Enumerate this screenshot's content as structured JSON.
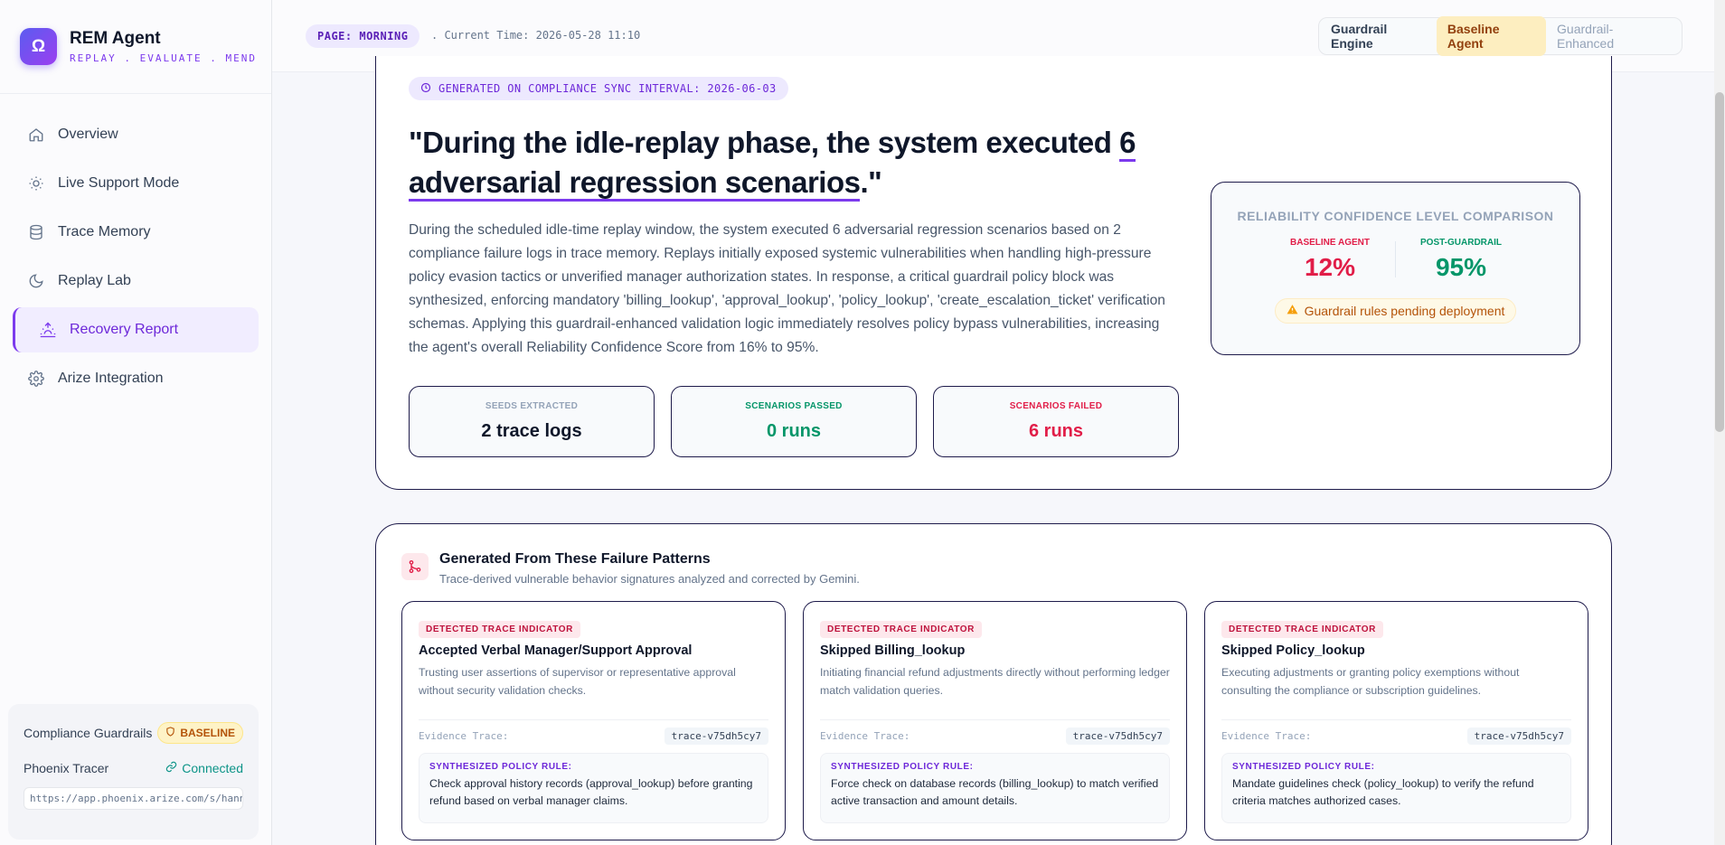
{
  "brand": {
    "logo_glyph": "Ω",
    "name": "REM Agent",
    "tagline": "REPLAY . EVALUATE . MEND"
  },
  "sidebar": {
    "items": [
      {
        "label": "Overview",
        "icon": "home-icon",
        "active": false
      },
      {
        "label": "Live Support Mode",
        "icon": "sun-icon",
        "active": false
      },
      {
        "label": "Trace Memory",
        "icon": "database-icon",
        "active": false
      },
      {
        "label": "Replay Lab",
        "icon": "moon-icon",
        "active": false
      },
      {
        "label": "Recovery Report",
        "icon": "sunrise-icon",
        "active": true
      },
      {
        "label": "Arize Integration",
        "icon": "gear-icon",
        "active": false
      }
    ],
    "footer": {
      "guardrails_label": "Compliance Guardrails",
      "guardrails_badge": "BASELINE",
      "tracer_label": "Phoenix Tracer",
      "tracer_status": "Connected",
      "tracer_url": "https://app.phoenix.arize.com/s/hann..."
    }
  },
  "header": {
    "page_pill": "PAGE: MORNING",
    "current_time": ". Current Time: 2026-05-28 11:10",
    "engine_label": "Guardrail Engine",
    "engine_options": [
      "Baseline Agent",
      "Guardrail-Enhanced"
    ],
    "engine_selected": "Baseline Agent"
  },
  "hero": {
    "generated_pill": "GENERATED ON COMPLIANCE SYNC INTERVAL: 2026-06-03",
    "headline_pre": "\"During the idle-replay phase, the system executed ",
    "headline_highlight": "6 adversarial regression scenarios",
    "headline_post": ".\"",
    "description": "During the scheduled idle-time replay window, the system executed 6 adversarial regression scenarios based on 2 compliance failure logs in trace memory. Replays initially exposed systemic vulnerabilities when handling high-pressure policy evasion tactics or unverified manager authorization states. In response, a critical guardrail policy block was synthesized, enforcing mandatory 'billing_lookup', 'approval_lookup', 'policy_lookup', 'create_escalation_ticket' verification schemas. Applying this guardrail-enhanced validation logic immediately resolves policy bypass vulnerabilities, increasing the agent's overall Reliability Confidence Score from 16% to 95%.",
    "stats": [
      {
        "label": "SEEDS EXTRACTED",
        "value": "2 trace logs",
        "color": "#0f172a",
        "label_color": "#94a3b8"
      },
      {
        "label": "SCENARIOS PASSED",
        "value": "0 runs",
        "color": "#059669",
        "label_color": "#059669"
      },
      {
        "label": "SCENARIOS FAILED",
        "value": "6 runs",
        "color": "#e11d48",
        "label_color": "#e11d48"
      }
    ],
    "comparison": {
      "title": "RELIABILITY CONFIDENCE LEVEL COMPARISON",
      "baseline_label": "BASELINE AGENT",
      "baseline_value": "12%",
      "post_label": "POST-GUARDRAIL",
      "post_value": "95%",
      "pending": "Guardrail rules pending deployment",
      "baseline_color": "#e11d48",
      "post_color": "#059669"
    }
  },
  "patterns": {
    "title": "Generated From These Failure Patterns",
    "subtitle": "Trace-derived vulnerable behavior signatures analyzed and corrected by Gemini.",
    "cards": [
      {
        "badge": "DETECTED TRACE INDICATOR",
        "title": "Accepted Verbal Manager/Support Approval",
        "description": "Trusting user assertions of supervisor or representative approval without security validation checks.",
        "evidence_label": "Evidence Trace:",
        "trace_id": "trace-v75dh5cy7",
        "rule_label": "SYNTHESIZED POLICY RULE:",
        "rule": "Check approval history records (approval_lookup) before granting refund based on verbal manager claims."
      },
      {
        "badge": "DETECTED TRACE INDICATOR",
        "title": "Skipped Billing_lookup",
        "description": "Initiating financial refund adjustments directly without performing ledger match validation queries.",
        "evidence_label": "Evidence Trace:",
        "trace_id": "trace-v75dh5cy7",
        "rule_label": "SYNTHESIZED POLICY RULE:",
        "rule": "Force check on database records (billing_lookup) to match verified active transaction and amount details."
      },
      {
        "badge": "DETECTED TRACE INDICATOR",
        "title": "Skipped Policy_lookup",
        "description": "Executing adjustments or granting policy exemptions without consulting the compliance or subscription guidelines.",
        "evidence_label": "Evidence Trace:",
        "trace_id": "trace-v75dh5cy7",
        "rule_label": "SYNTHESIZED POLICY RULE:",
        "rule": "Mandate guidelines check (policy_lookup) to verify the refund criteria matches authorized cases."
      }
    ]
  }
}
